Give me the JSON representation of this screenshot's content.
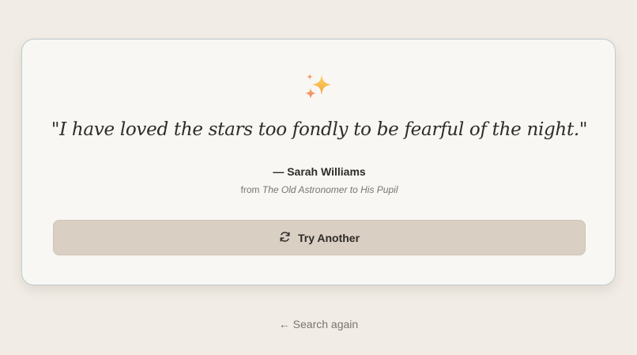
{
  "card": {
    "icon": "sparkles-icon",
    "quote": "\"I have loved the stars too fondly to be fearful of the night.\"",
    "author": "— Sarah Williams",
    "source_prefix": "from ",
    "source_title": "The Old Astronomer to His Pupil",
    "try_another_label": "Try Another",
    "try_another_icon": "refresh-icon"
  },
  "footer": {
    "search_again_label": "← Search again"
  },
  "colors": {
    "background": "#f1ece5",
    "card": "#f8f7f4",
    "card_border": "#bccdcc",
    "button": "#d9cfc3",
    "text": "#2f2b27",
    "muted_text": "#7a7470"
  }
}
